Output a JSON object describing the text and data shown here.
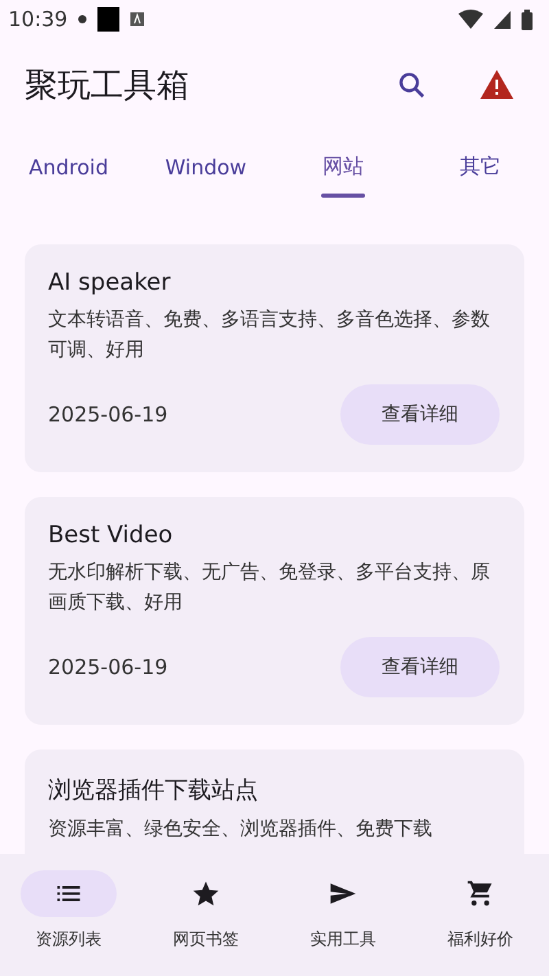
{
  "status_bar": {
    "time": "10:39"
  },
  "app_bar": {
    "title": "聚玩工具箱"
  },
  "tabs": [
    {
      "label": "Android",
      "selected": false
    },
    {
      "label": "Window",
      "selected": false
    },
    {
      "label": "网站",
      "selected": true
    },
    {
      "label": "其它",
      "selected": false
    }
  ],
  "cards": [
    {
      "title": "AI speaker",
      "description": "文本转语音、免费、多语言支持、多音色选择、参数可调、好用",
      "date": "2025-06-19",
      "button": "查看详细"
    },
    {
      "title": "Best Video",
      "description": "无水印解析下载、无广告、免登录、多平台支持、原画质下载、好用",
      "date": "2025-06-19",
      "button": "查看详细"
    },
    {
      "title": "浏览器插件下载站点",
      "description": "资源丰富、绿色安全、浏览器插件、免费下载"
    }
  ],
  "bottom_nav": [
    {
      "label": "资源列表",
      "kind": "list",
      "selected": true
    },
    {
      "label": "网页书签",
      "kind": "star",
      "selected": false
    },
    {
      "label": "实用工具",
      "kind": "send",
      "selected": false
    },
    {
      "label": "福利好价",
      "kind": "cart",
      "selected": false
    }
  ]
}
